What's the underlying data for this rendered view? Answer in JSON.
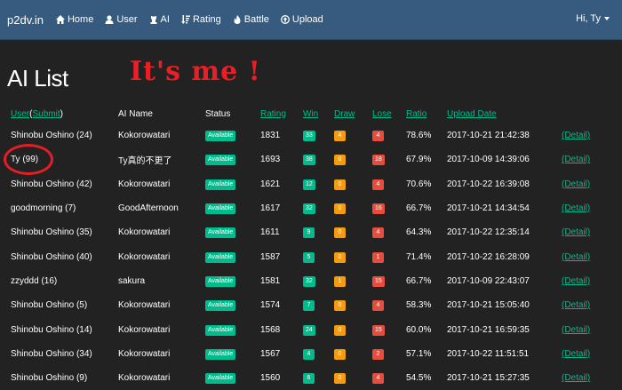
{
  "nav": {
    "brand": "p2dv.in",
    "items": [
      {
        "label": "Home",
        "icon": "home-icon"
      },
      {
        "label": "User",
        "icon": "user-icon"
      },
      {
        "label": "AI",
        "icon": "chess-piece-icon"
      },
      {
        "label": "Rating",
        "icon": "sort-icon"
      },
      {
        "label": "Battle",
        "icon": "fire-icon"
      },
      {
        "label": "Upload",
        "icon": "upload-icon"
      }
    ],
    "user_menu": "Hi, Ty"
  },
  "page_title": "AI List",
  "annotation": "It's me !",
  "table": {
    "headers": {
      "user": "User",
      "submit": "Submit",
      "ai_name": "AI Name",
      "status": "Status",
      "rating": "Rating",
      "win": "Win",
      "draw": "Draw",
      "lose": "Lose",
      "ratio": "Ratio",
      "upload_date": "Upload Date"
    },
    "rows": [
      {
        "user": "Shinobu Oshino (24)",
        "ai": "Kokorowatari",
        "status": "Available",
        "rating": "1831",
        "win": "33",
        "draw": "4",
        "lose": "4",
        "ratio": "78.6%",
        "date": "2017-10-21 21:42:38",
        "detail": "(Detail)"
      },
      {
        "user": "Ty (99)",
        "ai": "Ty真的不更了",
        "status": "Available",
        "rating": "1693",
        "win": "38",
        "draw": "0",
        "lose": "18",
        "ratio": "67.9%",
        "date": "2017-10-09 14:39:06",
        "detail": "(Detail)"
      },
      {
        "user": "Shinobu Oshino (42)",
        "ai": "Kokorowatari",
        "status": "Available",
        "rating": "1621",
        "win": "12",
        "draw": "0",
        "lose": "4",
        "ratio": "70.6%",
        "date": "2017-10-22 16:39:08",
        "detail": "(Detail)"
      },
      {
        "user": "goodmorning (7)",
        "ai": "GoodAfternoon",
        "status": "Available",
        "rating": "1617",
        "win": "32",
        "draw": "0",
        "lose": "16",
        "ratio": "66.7%",
        "date": "2017-10-21 14:34:54",
        "detail": "(Detail)"
      },
      {
        "user": "Shinobu Oshino (35)",
        "ai": "Kokorowatari",
        "status": "Available",
        "rating": "1611",
        "win": "9",
        "draw": "0",
        "lose": "4",
        "ratio": "64.3%",
        "date": "2017-10-22 12:35:14",
        "detail": "(Detail)"
      },
      {
        "user": "Shinobu Oshino (40)",
        "ai": "Kokorowatari",
        "status": "Available",
        "rating": "1587",
        "win": "5",
        "draw": "0",
        "lose": "1",
        "ratio": "71.4%",
        "date": "2017-10-22 16:28:09",
        "detail": "(Detail)"
      },
      {
        "user": "zzyddd (16)",
        "ai": "sakura",
        "status": "Available",
        "rating": "1581",
        "win": "32",
        "draw": "1",
        "lose": "15",
        "ratio": "66.7%",
        "date": "2017-10-09 22:43:07",
        "detail": "(Detail)"
      },
      {
        "user": "Shinobu Oshino (5)",
        "ai": "Kokorowatari",
        "status": "Available",
        "rating": "1574",
        "win": "7",
        "draw": "0",
        "lose": "4",
        "ratio": "58.3%",
        "date": "2017-10-21 15:05:40",
        "detail": "(Detail)"
      },
      {
        "user": "Shinobu Oshino (14)",
        "ai": "Kokorowatari",
        "status": "Available",
        "rating": "1568",
        "win": "24",
        "draw": "0",
        "lose": "15",
        "ratio": "60.0%",
        "date": "2017-10-21 16:59:35",
        "detail": "(Detail)"
      },
      {
        "user": "Shinobu Oshino (34)",
        "ai": "Kokorowatari",
        "status": "Available",
        "rating": "1567",
        "win": "4",
        "draw": "0",
        "lose": "2",
        "ratio": "57.1%",
        "date": "2017-10-22 11:51:51",
        "detail": "(Detail)"
      },
      {
        "user": "Shinobu Oshino (9)",
        "ai": "Kokorowatari",
        "status": "Available",
        "rating": "1560",
        "win": "6",
        "draw": "0",
        "lose": "4",
        "ratio": "54.5%",
        "date": "2017-10-21 15:27:35",
        "detail": "(Detail)"
      }
    ]
  }
}
